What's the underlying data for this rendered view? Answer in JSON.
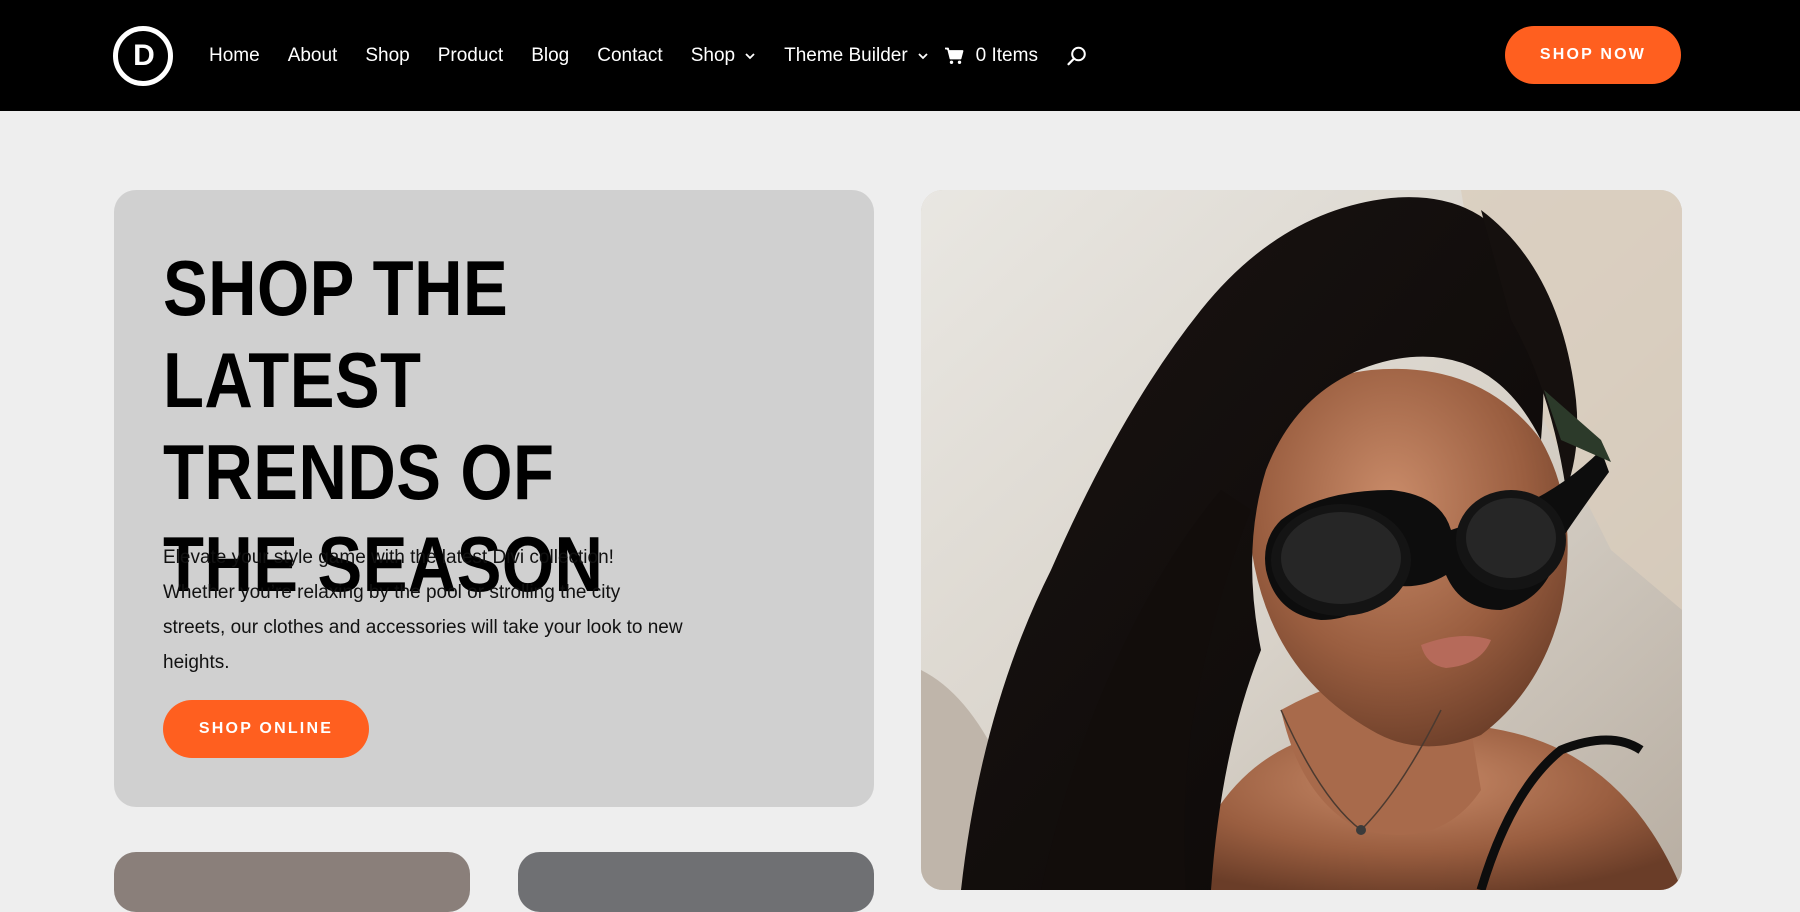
{
  "header": {
    "logo_letter": "D",
    "nav": [
      {
        "label": "Home"
      },
      {
        "label": "About"
      },
      {
        "label": "Shop"
      },
      {
        "label": "Product"
      },
      {
        "label": "Blog"
      },
      {
        "label": "Contact"
      },
      {
        "label": "Shop",
        "dropdown": true
      },
      {
        "label": "Theme Builder",
        "dropdown": true
      }
    ],
    "cart_label": "0 Items",
    "cta_label": "SHOP NOW"
  },
  "hero": {
    "title": "Shop the latest trends of the season",
    "text": "Elevate your style game with the latest Divi collection! Whether you’re relaxing by the pool or strolling the city streets, our clothes and accessories will take your look to new heights.",
    "cta_label": "SHOP ONLINE"
  },
  "colors": {
    "header_bg": "#000000",
    "page_bg": "#eeeeee",
    "card_bg": "#d0d0d0",
    "accent": "#ff5f1f"
  },
  "icons": [
    "divi-logo-icon",
    "chevron-down-icon",
    "cart-icon",
    "search-icon"
  ]
}
